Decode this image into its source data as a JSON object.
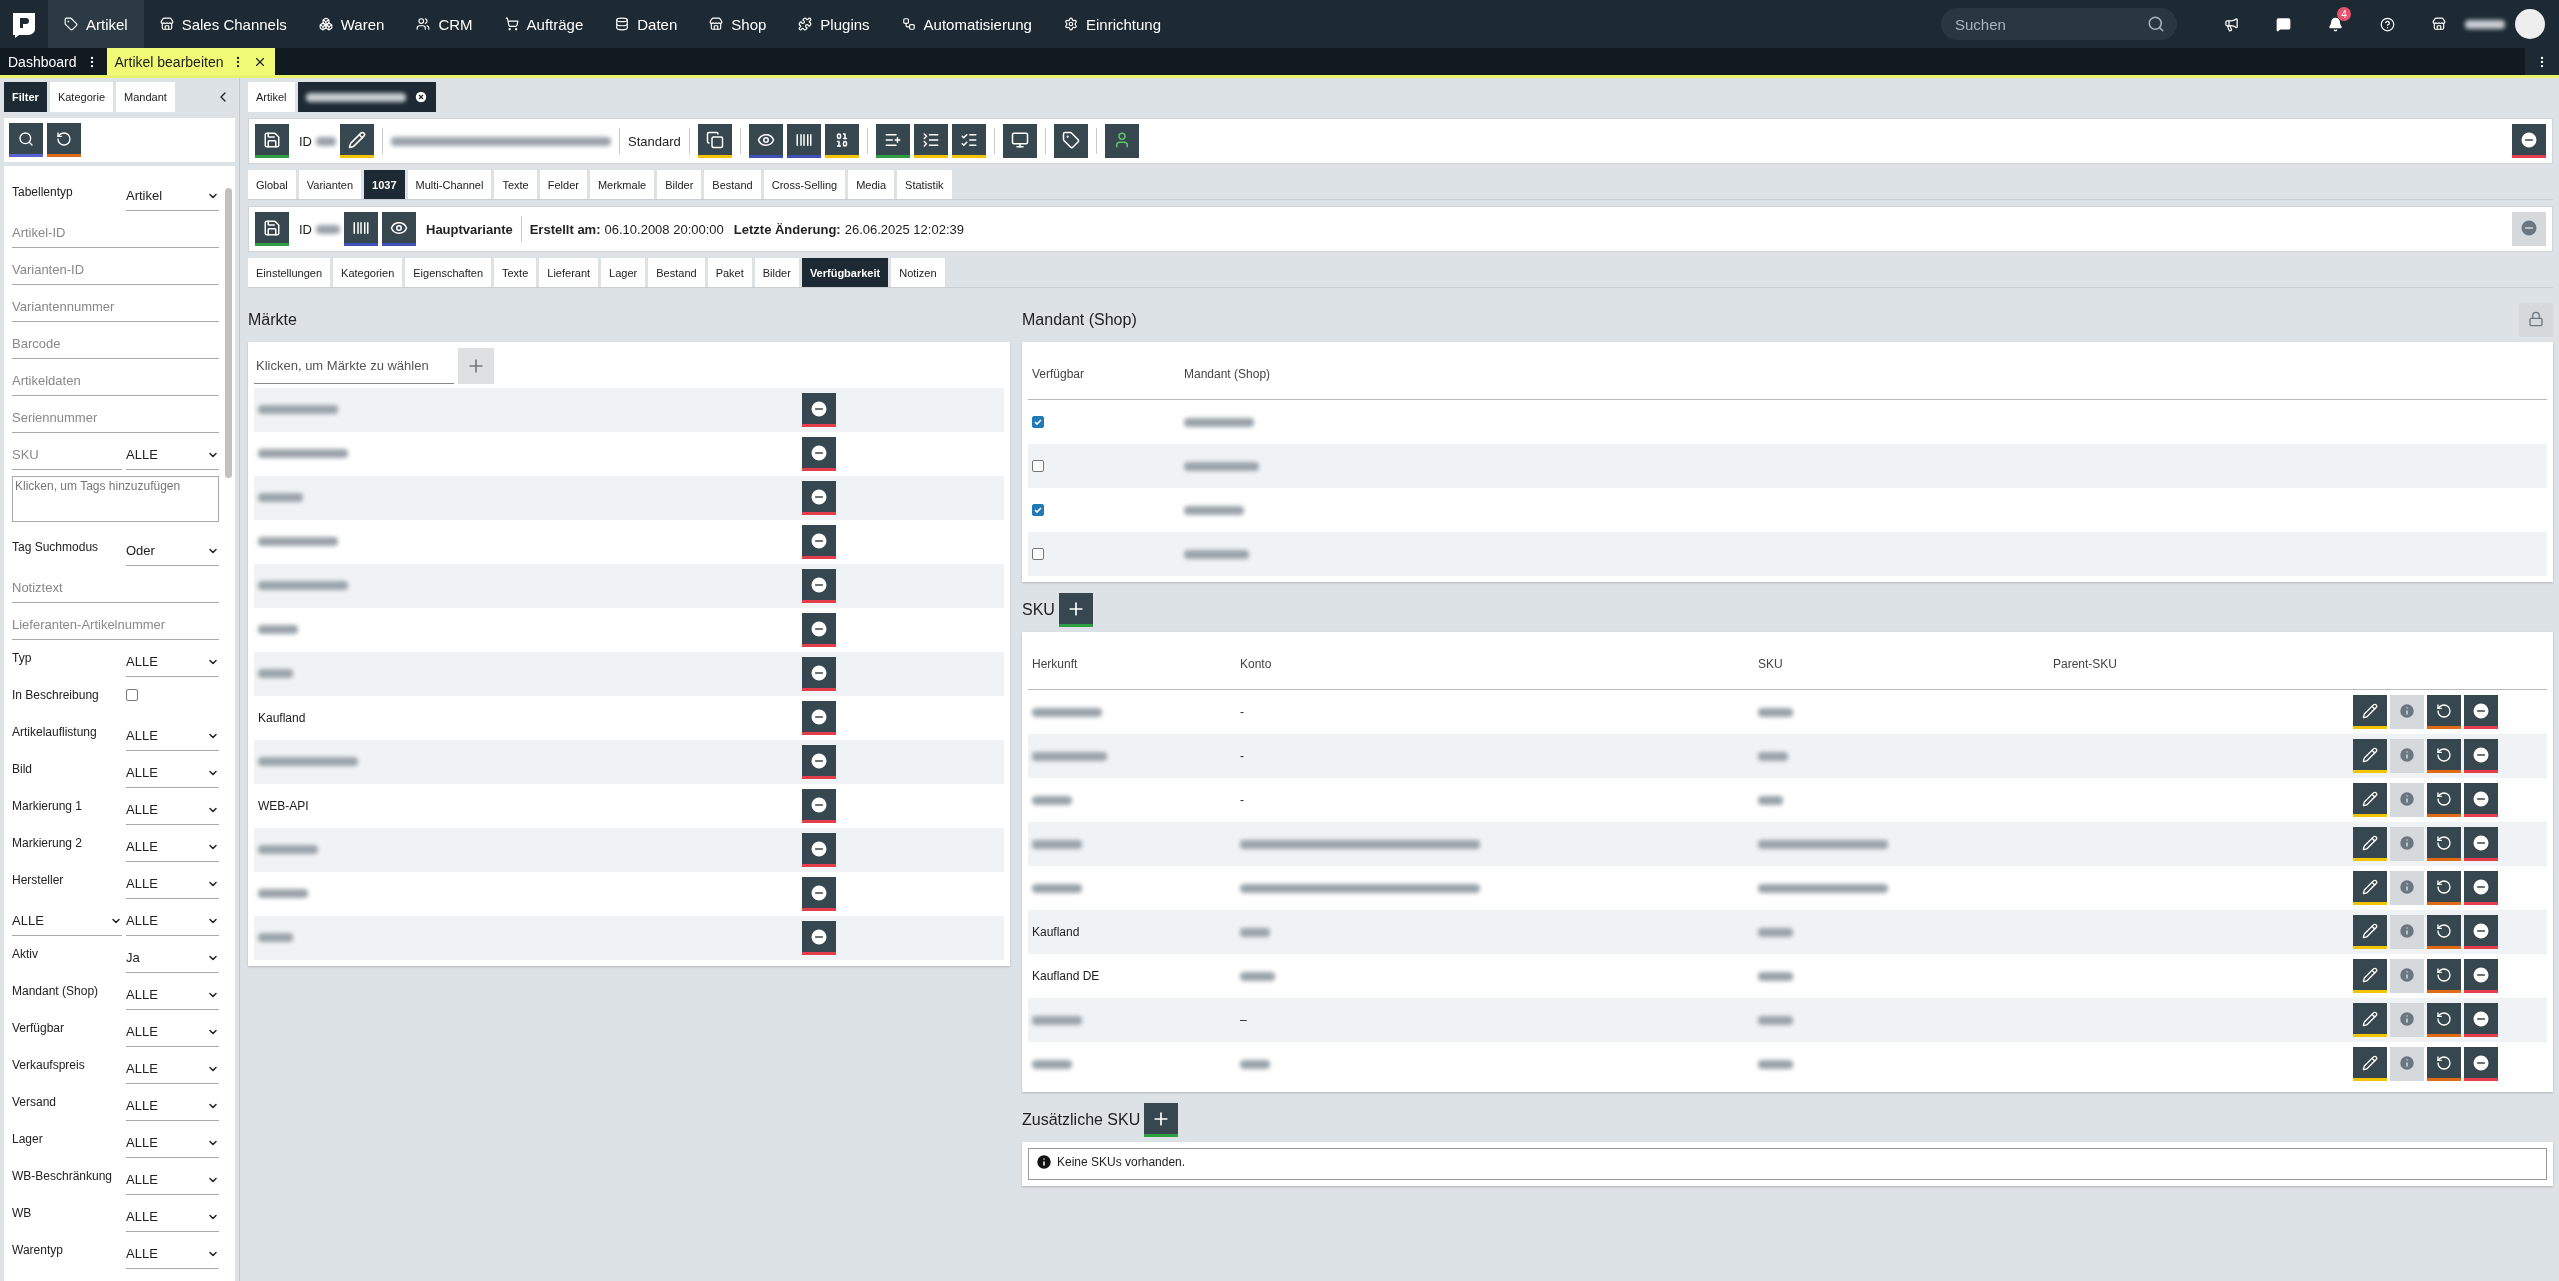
{
  "topnav": {
    "items": [
      {
        "label": "Artikel",
        "selected": true
      },
      {
        "label": "Sales Channels",
        "selected": false
      },
      {
        "label": "Waren",
        "selected": false
      },
      {
        "label": "CRM",
        "selected": false
      },
      {
        "label": "Aufträge",
        "selected": false
      },
      {
        "label": "Daten",
        "selected": false
      },
      {
        "label": "Shop",
        "selected": false
      },
      {
        "label": "Plugins",
        "selected": false
      },
      {
        "label": "Automatisierung",
        "selected": false
      },
      {
        "label": "Einrichtung",
        "selected": false
      }
    ],
    "search": {
      "placeholder": "Suchen"
    },
    "notification_count": "4"
  },
  "view_tabs": [
    {
      "label": "Dashboard",
      "selected": false
    },
    {
      "label": "Artikel bearbeiten",
      "selected": true
    }
  ],
  "sidebar": {
    "tabs": [
      {
        "label": "Filter",
        "selected": true
      },
      {
        "label": "Kategorie",
        "selected": false
      },
      {
        "label": "Mandant",
        "selected": false
      }
    ],
    "filters": [
      {
        "kind": "select",
        "label": "Tabellentyp",
        "value": "Artikel"
      },
      {
        "kind": "text",
        "placeholder": "Artikel-ID"
      },
      {
        "kind": "text",
        "placeholder": "Varianten-ID"
      },
      {
        "kind": "text",
        "placeholder": "Variantennummer"
      },
      {
        "kind": "text",
        "placeholder": "Barcode"
      },
      {
        "kind": "text",
        "placeholder": "Artikeldaten"
      },
      {
        "kind": "text",
        "placeholder": "Seriennummer"
      },
      {
        "kind": "textselect",
        "placeholder": "SKU",
        "value": "ALLE"
      },
      {
        "kind": "tags",
        "placeholder": "Klicken, um Tags hinzuzufügen"
      },
      {
        "kind": "select",
        "label": "Tag Suchmodus",
        "value": "Oder"
      },
      {
        "kind": "text",
        "placeholder": "Notiztext"
      },
      {
        "kind": "text",
        "placeholder": "Lieferanten-Artikelnummer"
      },
      {
        "kind": "select",
        "label": "Typ",
        "value": "ALLE"
      },
      {
        "kind": "checkbox",
        "label": "In Beschreibung",
        "checked": false
      },
      {
        "kind": "select",
        "label": "Artikelauflistung",
        "value": "ALLE"
      },
      {
        "kind": "select",
        "label": "Bild",
        "value": "ALLE"
      },
      {
        "kind": "select",
        "label": "Markierung 1",
        "value": "ALLE"
      },
      {
        "kind": "select",
        "label": "Markierung 2",
        "value": "ALLE"
      },
      {
        "kind": "select",
        "label": "Hersteller",
        "value": "ALLE"
      },
      {
        "kind": "doubleselect",
        "value": "ALLE",
        "value2": "ALLE"
      },
      {
        "kind": "select",
        "label": "Aktiv",
        "value": "Ja"
      },
      {
        "kind": "select",
        "label": "Mandant (Shop)",
        "value": "ALLE"
      },
      {
        "kind": "select",
        "label": "Verfügbar",
        "value": "ALLE"
      },
      {
        "kind": "select",
        "label": "Verkaufspreis",
        "value": "ALLE"
      },
      {
        "kind": "select",
        "label": "Versand",
        "value": "ALLE"
      },
      {
        "kind": "select",
        "label": "Lager",
        "value": "ALLE"
      },
      {
        "kind": "select",
        "label": "WB-Beschränkung",
        "value": "ALLE"
      },
      {
        "kind": "select",
        "label": "WB",
        "value": "ALLE"
      },
      {
        "kind": "select",
        "label": "Warentyp",
        "value": "ALLE"
      }
    ]
  },
  "doc_tabs": [
    {
      "label": "Artikel",
      "selected": false
    },
    {
      "redacted": true,
      "selected": true
    }
  ],
  "article_bar": {
    "id_label": "ID",
    "standard": "Standard",
    "buttons": [
      {
        "color": "#f5c400"
      },
      {
        "color": "#3f51b5"
      },
      {
        "color": "#3f51b5"
      },
      {
        "color": "#f5c400"
      },
      {
        "color": "#2e9e44"
      },
      {
        "color": "#f5c400"
      },
      {
        "color": "#f5c400"
      },
      {
        "color": "#37474f"
      },
      {
        "color": "#37474f"
      },
      {
        "color": "#37474f"
      }
    ]
  },
  "main_tabs": [
    {
      "label": "Global",
      "selected": false
    },
    {
      "label": "Varianten",
      "selected": false
    },
    {
      "label": "1037",
      "selected": true
    },
    {
      "label": "Multi-Channel",
      "selected": false
    },
    {
      "label": "Texte",
      "selected": false
    },
    {
      "label": "Felder",
      "selected": false
    },
    {
      "label": "Merkmale",
      "selected": false
    },
    {
      "label": "Bilder",
      "selected": false
    },
    {
      "label": "Bestand",
      "selected": false
    },
    {
      "label": "Cross-Selling",
      "selected": false
    },
    {
      "label": "Media",
      "selected": false
    },
    {
      "label": "Statistik",
      "selected": false
    }
  ],
  "variant_bar": {
    "id_label": "ID",
    "variant": "Hauptvariante",
    "created_label": "Erstellt am:",
    "created": "06.10.2008 20:00:00",
    "changed_label": "Letzte Änderung:",
    "changed": "26.06.2025 12:02:39"
  },
  "variant_tabs": [
    {
      "label": "Einstellungen",
      "selected": false
    },
    {
      "label": "Kategorien",
      "selected": false
    },
    {
      "label": "Eigenschaften",
      "selected": false
    },
    {
      "label": "Texte",
      "selected": false
    },
    {
      "label": "Lieferant",
      "selected": false
    },
    {
      "label": "Lager",
      "selected": false
    },
    {
      "label": "Bestand",
      "selected": false
    },
    {
      "label": "Paket",
      "selected": false
    },
    {
      "label": "Bilder",
      "selected": false
    },
    {
      "label": "Verfügbarkeit",
      "selected": true
    },
    {
      "label": "Notizen",
      "selected": false
    }
  ],
  "markets": {
    "title": "Märkte",
    "placeholder": "Klicken, um Märkte zu wählen",
    "rows": [
      {
        "redacted": true
      },
      {
        "redacted": true
      },
      {
        "redacted": true
      },
      {
        "redacted": true
      },
      {
        "redacted": true
      },
      {
        "redacted": true
      },
      {
        "redacted": true
      },
      {
        "name": "Kaufland"
      },
      {
        "redacted": true
      },
      {
        "name": "WEB-API"
      },
      {
        "redacted": true
      },
      {
        "redacted": true
      },
      {
        "redacted": true
      }
    ]
  },
  "clients": {
    "title": "Mandant (Shop)",
    "columns": [
      "Verfügbar",
      "Mandant (Shop)"
    ],
    "rows": [
      {
        "checked": true,
        "redacted": true
      },
      {
        "checked": false,
        "redacted": true
      },
      {
        "checked": true,
        "redacted": true
      },
      {
        "checked": false,
        "redacted": true
      }
    ]
  },
  "sku": {
    "title": "SKU",
    "columns": [
      "Herkunft",
      "Konto",
      "SKU",
      "Parent-SKU"
    ],
    "rows": [
      {
        "origin": {
          "redacted": true
        },
        "account": {
          "text": "-"
        },
        "sku": {
          "redacted": true
        }
      },
      {
        "origin": {
          "redacted": true
        },
        "account": {
          "text": "-"
        },
        "sku": {
          "redacted": true
        }
      },
      {
        "origin": {
          "redacted": true
        },
        "account": {
          "text": "-"
        },
        "sku": {
          "redacted": true
        }
      },
      {
        "origin": {
          "redacted": true
        },
        "account": {
          "redacted": true
        },
        "sku": {
          "redacted": true
        }
      },
      {
        "origin": {
          "redacted": true
        },
        "account": {
          "redacted": true
        },
        "sku": {
          "redacted": true
        }
      },
      {
        "origin": {
          "text": "Kaufland"
        },
        "account": {
          "redacted": true
        },
        "sku": {
          "redacted": true
        }
      },
      {
        "origin": {
          "text": "Kaufland DE"
        },
        "account": {
          "redacted": true
        },
        "sku": {
          "redacted": true
        }
      },
      {
        "origin": {
          "redacted": true
        },
        "account": {
          "text": "–"
        },
        "sku": {
          "redacted": true
        }
      },
      {
        "origin": {
          "redacted": true
        },
        "account": {
          "redacted": true
        },
        "sku": {
          "redacted": true
        }
      }
    ]
  },
  "extra_sku": {
    "title": "Zusätzliche SKU",
    "empty": "Keine SKUs vorhanden."
  }
}
